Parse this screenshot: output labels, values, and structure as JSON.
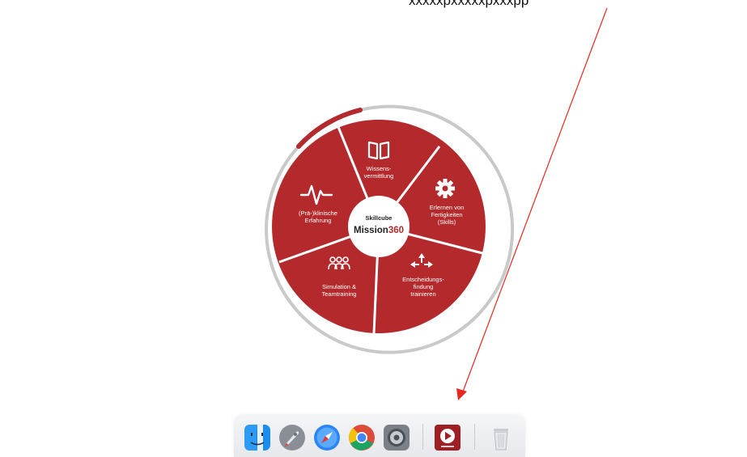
{
  "caption": "xxxxxpxxxxxpxxxpp",
  "wheel": {
    "center_line1": "Skillcube",
    "center_line2_a": "Mission",
    "center_line2_b": "360",
    "segments": [
      {
        "line1": "Wissens-",
        "line2": "vermittlung",
        "line3": "",
        "icon": "book-icon"
      },
      {
        "line1": "Erlernen von",
        "line2": "Fertigkeiten",
        "line3": "(Skills)",
        "icon": "gear-icon"
      },
      {
        "line1": "Entscheidungs-",
        "line2": "findung",
        "line3": "trainieren",
        "icon": "arrows-icon"
      },
      {
        "line1": "Simulation &",
        "line2": "Teamtraining",
        "line3": "",
        "icon": "team-icon"
      },
      {
        "line1": "(Prä-)klinische",
        "line2": "Erfahrung",
        "line3": "",
        "icon": "heartbeat-icon"
      }
    ],
    "colors": {
      "primary": "#b3292c",
      "center": "#ffffff",
      "accent360": "#b3292c"
    }
  },
  "dock": {
    "items": [
      {
        "name": "finder",
        "icon": "finder-icon"
      },
      {
        "name": "launchpad",
        "icon": "rocket-icon"
      },
      {
        "name": "safari",
        "icon": "compass-icon"
      },
      {
        "name": "chrome",
        "icon": "chrome-icon"
      },
      {
        "name": "system-preferences",
        "icon": "gear-icon"
      },
      {
        "name": "skillcube-app",
        "icon": "play-icon"
      },
      {
        "name": "trash",
        "icon": "trash-icon"
      }
    ]
  },
  "annotation": {
    "color": "#e8281e"
  }
}
